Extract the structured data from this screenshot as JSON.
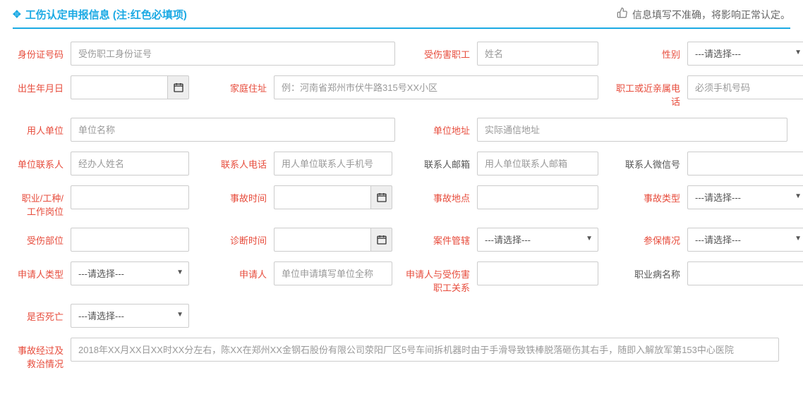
{
  "header": {
    "title": "工伤认定申报信息 (注:红色必填项)",
    "notice": "信息填写不准确，将影响正常认定。"
  },
  "labels": {
    "id_no": "身份证号码",
    "victim": "受伤害职工",
    "gender": "性别",
    "dob": "出生年月日",
    "home_addr": "家庭住址",
    "relative_phone": "职工或近亲属电话",
    "employer": "用人单位",
    "employer_addr": "单位地址",
    "unit_contact": "单位联系人",
    "contact_phone": "联系人电话",
    "contact_email": "联系人邮箱",
    "contact_wechat": "联系人微信号",
    "occupation": "职业/工种/工作岗位",
    "accident_time": "事故时间",
    "accident_place": "事故地点",
    "accident_type": "事故类型",
    "injury_part": "受伤部位",
    "diagnosis_time": "诊断时间",
    "case_jurisdiction": "案件管辖",
    "insurance": "参保情况",
    "applicant_type": "申请人类型",
    "applicant": "申请人",
    "applicant_relation": "申请人与受伤害职工关系",
    "disease_name": "职业病名称",
    "is_dead": "是否死亡",
    "accident_desc": "事故经过及救治情况"
  },
  "placeholders": {
    "id_no": "受伤职工身份证号",
    "victim": "姓名",
    "home_addr": "例：河南省郑州市伏牛路315号XX小区",
    "relative_phone": "必须手机号码",
    "employer": "单位名称",
    "employer_addr": "实际通信地址",
    "unit_contact": "经办人姓名",
    "contact_phone": "用人单位联系人手机号",
    "contact_email": "用人单位联系人邮箱",
    "applicant": "单位申请填写单位全称",
    "accident_desc": "2018年XX月XX日XX时XX分左右，陈XX在郑州XX金钢石股份有限公司荥阳厂区5号车间拆机器时由于手滑导致铁棒脱落砸伤其右手，随即入解放军第153中心医院"
  },
  "select_default": "---请选择---"
}
